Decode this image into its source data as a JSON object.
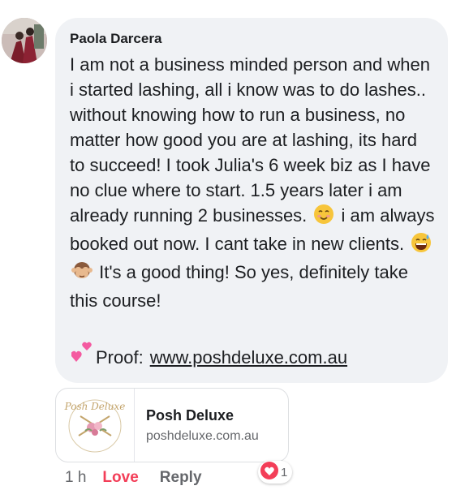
{
  "comment": {
    "author": "Paola Darcera",
    "body_lines_1": "I am not a business minded person and when i started lashing, all i know was to do lashes.. without knowing how to run a business, no matter how good you are at lashing, its hard to succeed! I took Julia's 6 week biz as I have no clue where to start. 1.5 years later i am already running 2 businesses.",
    "body_part_2": "i am always booked out now. I cant take in new clients.",
    "body_part_3": "It's a good thing! So yes, definitely take this course!",
    "proof_label": "Proof:",
    "proof_link": "www.poshdeluxe.com.au",
    "emojis": [
      "smiling-face-icon",
      "grinning-sweat-icon",
      "see-no-evil-monkey-icon",
      "two-hearts-icon"
    ]
  },
  "link_preview": {
    "logo_text": "Posh Deluxe",
    "title": "Posh Deluxe",
    "domain": "poshdeluxe.com.au"
  },
  "actions": {
    "time": "1 h",
    "love": "Love",
    "reply": "Reply",
    "reaction_count": "1"
  },
  "colors": {
    "bubble": "#f0f2f5",
    "love": "#f33e58",
    "meta": "#65676b"
  }
}
